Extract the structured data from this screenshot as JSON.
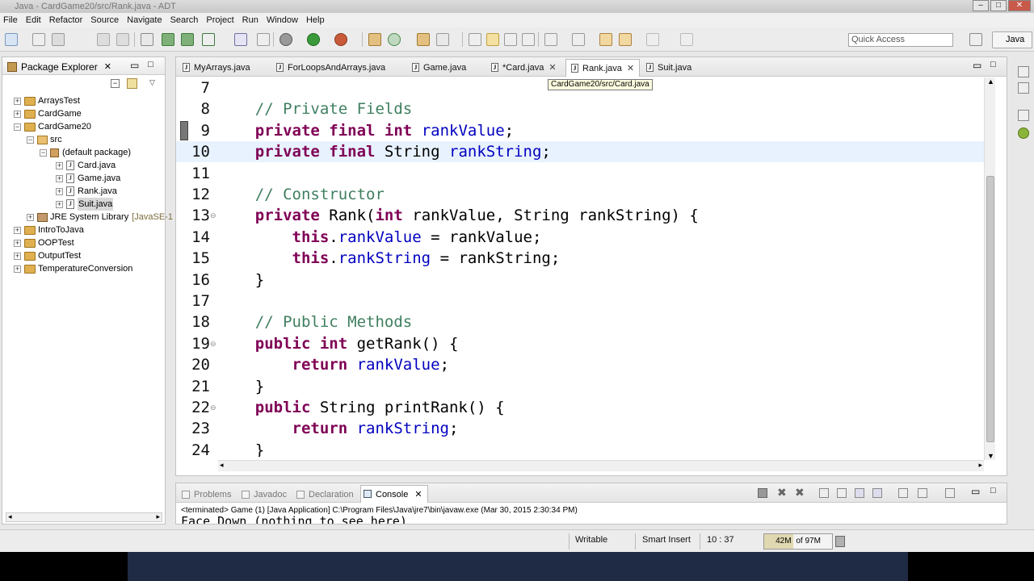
{
  "window": {
    "title": "Java - CardGame20/src/Rank.java - ADT",
    "min": "–",
    "max": "□",
    "close": "✕"
  },
  "menu": [
    "File",
    "Edit",
    "Refactor",
    "Source",
    "Navigate",
    "Search",
    "Project",
    "Run",
    "Window",
    "Help"
  ],
  "toolbar": {
    "quick_access_placeholder": "Quick Access",
    "perspective": "Java"
  },
  "package_explorer": {
    "title": "Package Explorer",
    "tree": [
      {
        "label": "ArraysTest",
        "kind": "project",
        "exp": "+"
      },
      {
        "label": "CardGame",
        "kind": "project",
        "exp": "+"
      },
      {
        "label": "CardGame20",
        "kind": "project",
        "exp": "−"
      },
      {
        "label": "src",
        "kind": "src",
        "exp": "−"
      },
      {
        "label": "(default package)",
        "kind": "package",
        "exp": "−"
      },
      {
        "label": "Card.java",
        "kind": "java",
        "exp": "+"
      },
      {
        "label": "Game.java",
        "kind": "java",
        "exp": "+"
      },
      {
        "label": "Rank.java",
        "kind": "java",
        "exp": "+"
      },
      {
        "label": "Suit.java",
        "kind": "java",
        "exp": "+"
      },
      {
        "label": "JRE System Library",
        "suffix": "[JavaSE-1",
        "kind": "library",
        "exp": "+"
      },
      {
        "label": "IntroToJava",
        "kind": "project",
        "exp": "+"
      },
      {
        "label": "OOPTest",
        "kind": "project",
        "exp": "+"
      },
      {
        "label": "OutputTest",
        "kind": "project",
        "exp": "+"
      },
      {
        "label": "TemperatureConversion",
        "kind": "project",
        "exp": "+"
      }
    ]
  },
  "editor": {
    "tabs": [
      {
        "label": "MyArrays.java"
      },
      {
        "label": "ForLoopsAndArrays.java"
      },
      {
        "label": "Game.java"
      },
      {
        "label": "*Card.java"
      },
      {
        "label": "Rank.java"
      },
      {
        "label": "Suit.java"
      }
    ],
    "tooltip": "CardGame20/src/Card.java",
    "lines": [
      {
        "n": "7",
        "tokens": []
      },
      {
        "n": "8",
        "tokens": [
          {
            "t": "    "
          },
          {
            "t": "// Private Fields",
            "c": "cm"
          }
        ]
      },
      {
        "n": "9",
        "tokens": [
          {
            "t": "    "
          },
          {
            "t": "private final int",
            "c": "kw"
          },
          {
            "t": " "
          },
          {
            "t": "rankValue",
            "c": "fld"
          },
          {
            "t": ";"
          }
        ]
      },
      {
        "n": "10",
        "tokens": [
          {
            "t": "    "
          },
          {
            "t": "private final",
            "c": "kw"
          },
          {
            "t": " String "
          },
          {
            "t": "rankString",
            "c": "fld"
          },
          {
            "t": ";"
          }
        ]
      },
      {
        "n": "11",
        "tokens": []
      },
      {
        "n": "12",
        "tokens": [
          {
            "t": "    "
          },
          {
            "t": "// Constructor",
            "c": "cm"
          }
        ]
      },
      {
        "n": "13",
        "fold": true,
        "tokens": [
          {
            "t": "    "
          },
          {
            "t": "private",
            "c": "kw"
          },
          {
            "t": " Rank("
          },
          {
            "t": "int",
            "c": "kw"
          },
          {
            "t": " rankValue, String rankString) {"
          }
        ]
      },
      {
        "n": "14",
        "tokens": [
          {
            "t": "        "
          },
          {
            "t": "this",
            "c": "kw"
          },
          {
            "t": "."
          },
          {
            "t": "rankValue",
            "c": "fld"
          },
          {
            "t": " = rankValue;"
          }
        ]
      },
      {
        "n": "15",
        "tokens": [
          {
            "t": "        "
          },
          {
            "t": "this",
            "c": "kw"
          },
          {
            "t": "."
          },
          {
            "t": "rankString",
            "c": "fld"
          },
          {
            "t": " = rankString;"
          }
        ]
      },
      {
        "n": "16",
        "tokens": [
          {
            "t": "    }"
          }
        ]
      },
      {
        "n": "17",
        "tokens": []
      },
      {
        "n": "18",
        "tokens": [
          {
            "t": "    "
          },
          {
            "t": "// Public Methods",
            "c": "cm"
          }
        ]
      },
      {
        "n": "19",
        "fold": true,
        "tokens": [
          {
            "t": "    "
          },
          {
            "t": "public int",
            "c": "kw"
          },
          {
            "t": " getRank() {"
          }
        ]
      },
      {
        "n": "20",
        "tokens": [
          {
            "t": "        "
          },
          {
            "t": "return",
            "c": "kw"
          },
          {
            "t": " "
          },
          {
            "t": "rankValue",
            "c": "fld"
          },
          {
            "t": ";"
          }
        ]
      },
      {
        "n": "21",
        "tokens": [
          {
            "t": "    }"
          }
        ]
      },
      {
        "n": "22",
        "fold": true,
        "tokens": [
          {
            "t": "    "
          },
          {
            "t": "public",
            "c": "kw"
          },
          {
            "t": " String printRank() {"
          }
        ]
      },
      {
        "n": "23",
        "tokens": [
          {
            "t": "        "
          },
          {
            "t": "return",
            "c": "kw"
          },
          {
            "t": " "
          },
          {
            "t": "rankString",
            "c": "fld"
          },
          {
            "t": ";"
          }
        ]
      },
      {
        "n": "24",
        "tokens": [
          {
            "t": "    }"
          }
        ]
      }
    ]
  },
  "console": {
    "tabs": [
      "Problems",
      "Javadoc",
      "Declaration",
      "Console"
    ],
    "status": "<terminated> Game (1) [Java Application] C:\\Program Files\\Java\\jre7\\bin\\javaw.exe (Mar 30, 2015 2:30:34 PM)",
    "output": "Face Down (nothing to see here)"
  },
  "statusbar": {
    "writable": "Writable",
    "insert_mode": "Smart Insert",
    "position": "10 : 37",
    "heap_used": "42M",
    "heap_total": "of 97M"
  }
}
